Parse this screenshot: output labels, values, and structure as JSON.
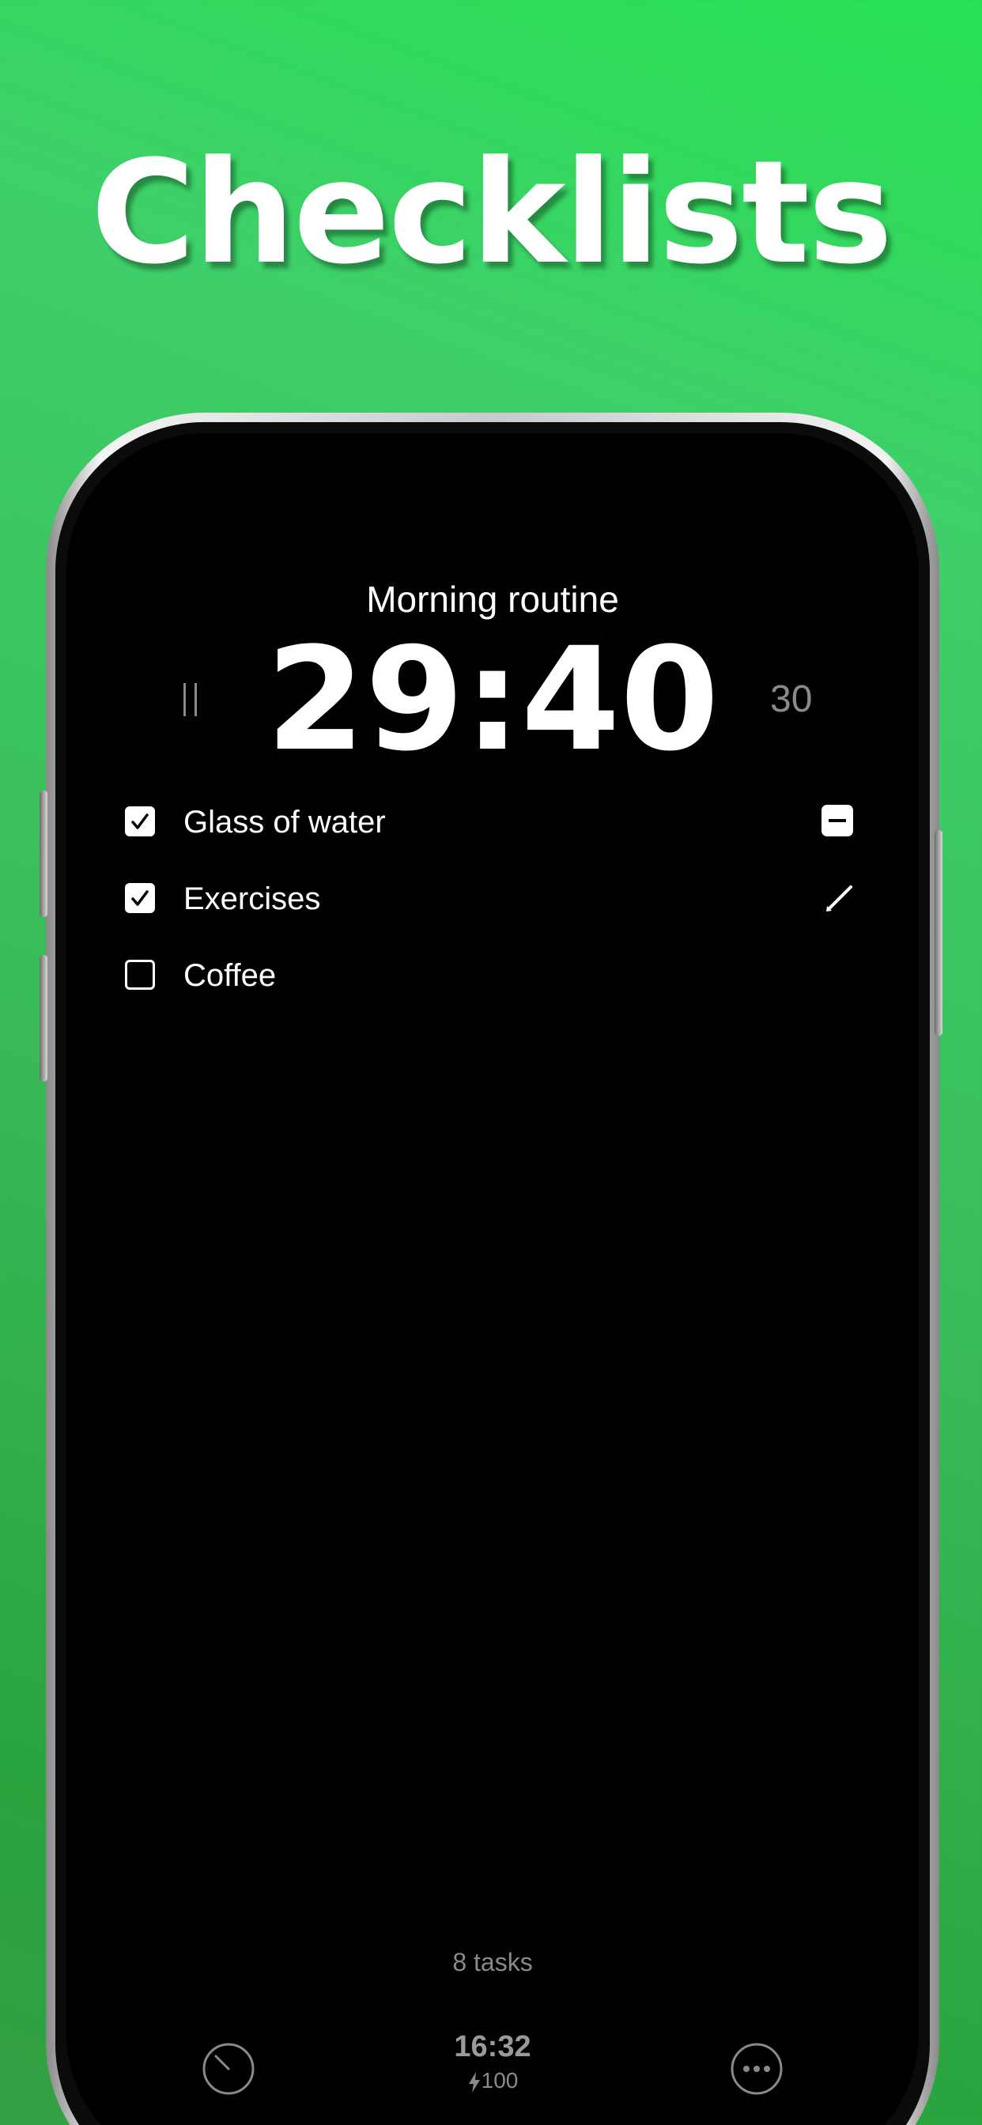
{
  "headline": "Checklists",
  "routine": {
    "title": "Morning routine",
    "timer": "29:40",
    "duration_minutes": "30"
  },
  "tasks": [
    {
      "label": "Glass of water",
      "checked": true
    },
    {
      "label": "Exercises",
      "checked": true
    },
    {
      "label": "Coffee",
      "checked": false
    }
  ],
  "footer": {
    "task_count": "8 tasks",
    "clock": "16:32",
    "battery": "100"
  },
  "icons": {
    "pause": "pause-icon",
    "check": "checkmark-icon",
    "remove": "minus-square-icon",
    "edit": "pencil-icon",
    "timer": "stopwatch-icon",
    "more": "ellipsis-circle-icon",
    "battery": "lightning-bolt-icon"
  },
  "colors": {
    "background_top": "#27e153",
    "background_bottom": "#33a044",
    "screen": "#000000",
    "text": "#ffffff",
    "muted": "#8a8a8a"
  }
}
